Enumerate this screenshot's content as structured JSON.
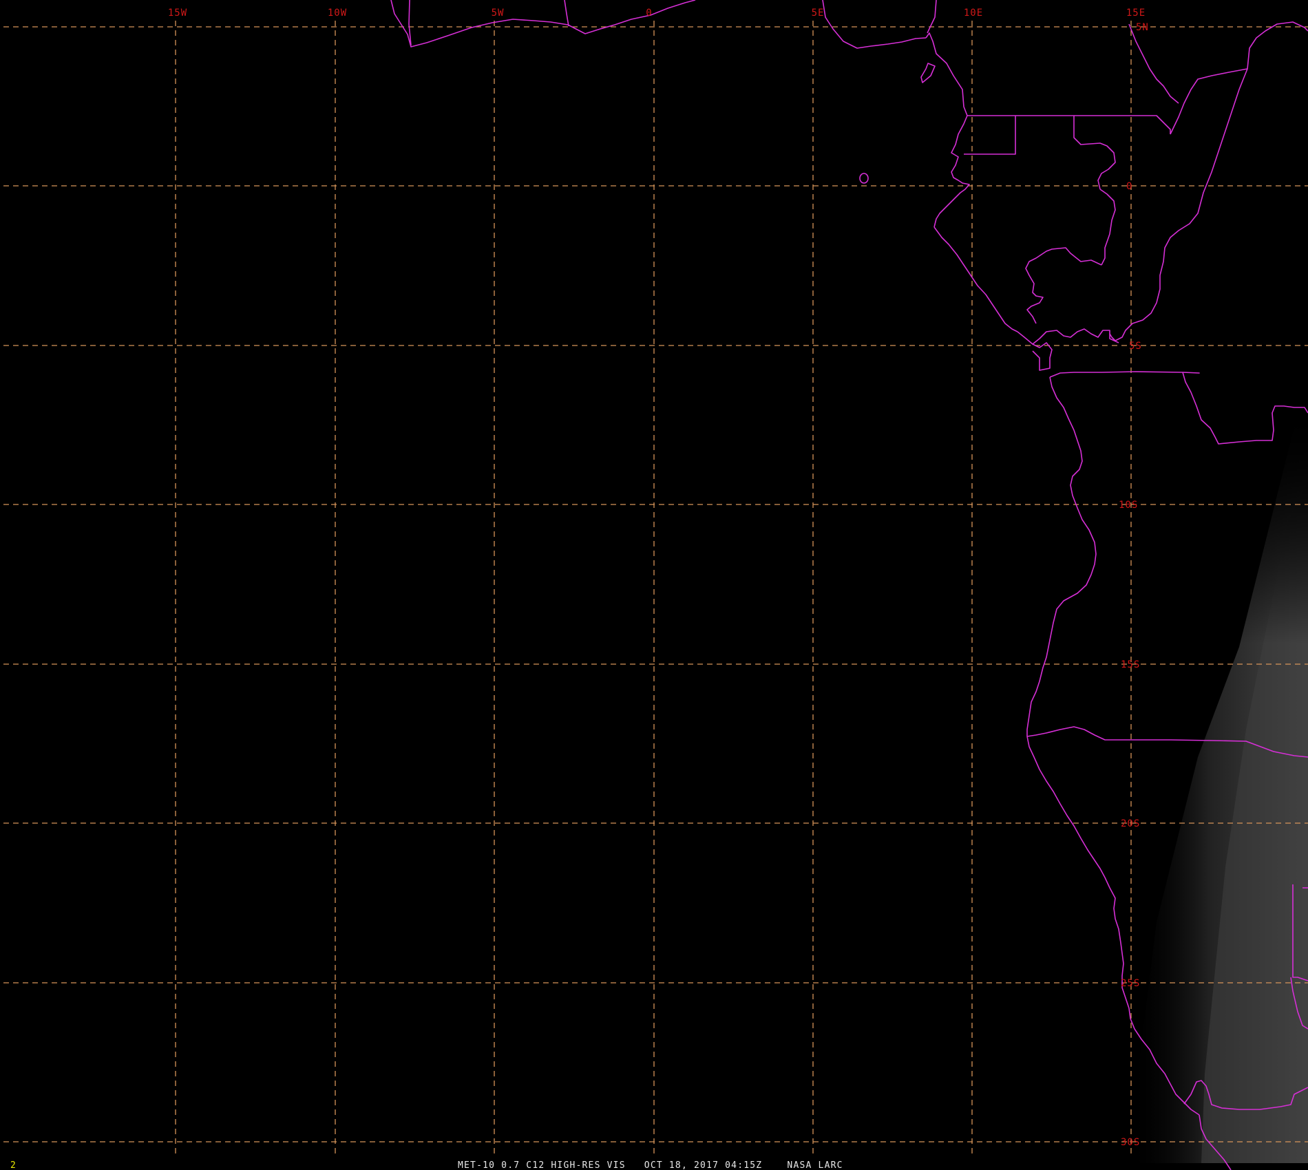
{
  "image": {
    "caption": "MET-10 0.7 C12 HIGH-RES VIS   OCT 18, 2017 04:15Z    NASA LARC",
    "frame_number": "2"
  },
  "grid": {
    "longitude_labels": [
      "15W",
      "10W",
      "5W",
      "0",
      "5E",
      "10E",
      "15E"
    ],
    "latitude_labels": [
      "5N",
      "0",
      "5S",
      "10S",
      "15S",
      "20S",
      "25S",
      "30S"
    ]
  },
  "colors": {
    "background": "#000000",
    "grid_line": "#d7955a",
    "grid_label": "#d01818",
    "border": "#d62fd6",
    "caption": "#e8e8e8",
    "frame_number": "#e8e800",
    "land_glow": "#4a4a4a"
  }
}
